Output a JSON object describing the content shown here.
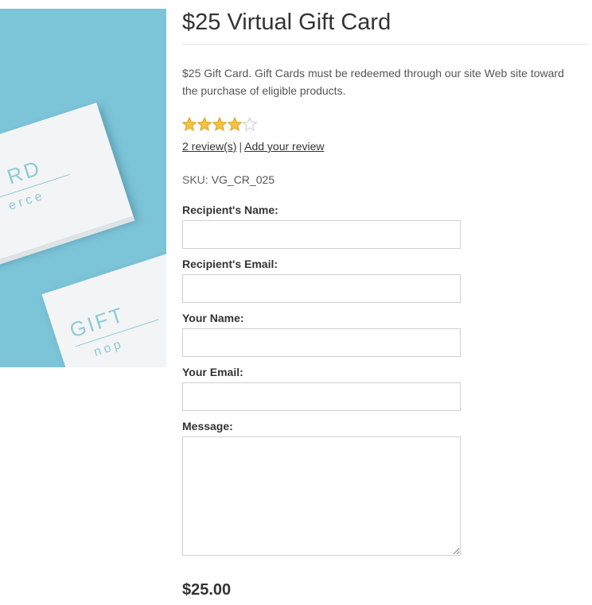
{
  "product": {
    "title": "$25 Virtual Gift Card",
    "description": "$25 Gift Card. Gift Cards must be redeemed through our site Web site toward the purchase of eligible products.",
    "image_text": {
      "card1_big": "RD",
      "card1_small": "erce",
      "card2_big": "GIFT",
      "card2_small": "nop"
    },
    "rating": {
      "value": 4,
      "max": 5,
      "filled_color": "#f5c242",
      "empty_color": "#cccccc"
    },
    "reviews_link": "2 review(s)",
    "separator": "|",
    "add_review_link": "Add your review",
    "sku_label": "SKU:",
    "sku_value": "VG_CR_025",
    "price": "$25.00"
  },
  "form": {
    "recipient_name_label": "Recipient's Name:",
    "recipient_name_value": "",
    "recipient_email_label": "Recipient's Email:",
    "recipient_email_value": "",
    "your_name_label": "Your Name:",
    "your_name_value": "",
    "your_email_label": "Your Email:",
    "your_email_value": "",
    "message_label": "Message:",
    "message_value": ""
  }
}
